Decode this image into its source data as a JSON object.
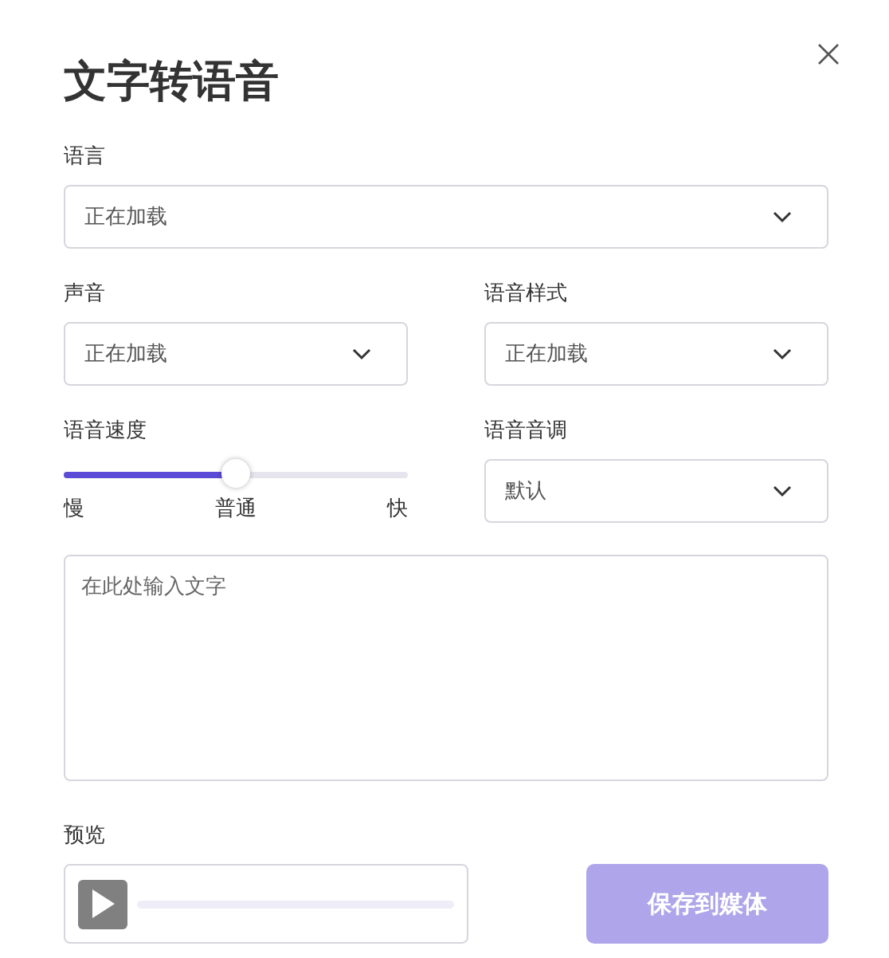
{
  "title": "文字转语音",
  "language": {
    "label": "语言",
    "value": "正在加载"
  },
  "voice": {
    "label": "声音",
    "value": "正在加载"
  },
  "style": {
    "label": "语音样式",
    "value": "正在加载"
  },
  "speed": {
    "label": "语音速度",
    "level": 0.5,
    "marks": [
      "慢",
      "普通",
      "快"
    ]
  },
  "pitch": {
    "label": "语音音调",
    "value": "默认"
  },
  "text_input": {
    "placeholder": "在此处输入文字"
  },
  "preview": {
    "label": "预览"
  },
  "save_button": {
    "label": "保存到媒体",
    "disabled": true
  }
}
